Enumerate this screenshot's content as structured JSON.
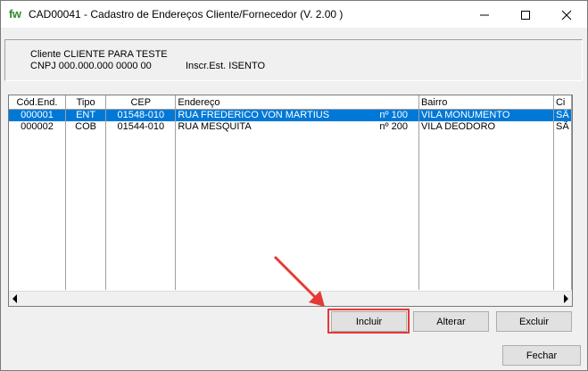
{
  "window": {
    "logo": "fw",
    "title": "CAD00041 - Cadastro de Endereços Cliente/Fornecedor  (V.  2.00 )"
  },
  "client": {
    "line1": "Cliente CLIENTE PARA TESTE",
    "cnpj": "CNPJ 000.000.000  0000  00",
    "inscr": "Inscr.Est.  ISENTO"
  },
  "grid": {
    "columns": [
      "Cód.End.",
      "Tipo",
      "CEP",
      "Endereço",
      "Bairro",
      "Ci"
    ],
    "rows": [
      {
        "cod": "000001",
        "tipo": "ENT",
        "cep": "01548-010",
        "endereco": "RUA FREDERICO VON MARTIUS",
        "numero": "nº 100",
        "bairro": "VILA MONUMENTO",
        "cidade": "SÃ"
      },
      {
        "cod": "000002",
        "tipo": "COB",
        "cep": "01544-010",
        "endereco": "RUA MESQUITA",
        "numero": "nº 200",
        "bairro": "VILA DEODORO",
        "cidade": "SÃ"
      }
    ]
  },
  "buttons": {
    "incluir": "Incluir",
    "alterar": "Alterar",
    "excluir": "Excluir",
    "fechar": "Fechar"
  },
  "colors": {
    "selection": "#0078d7",
    "annotation": "#e53935",
    "logo": "#2e8b2e"
  }
}
